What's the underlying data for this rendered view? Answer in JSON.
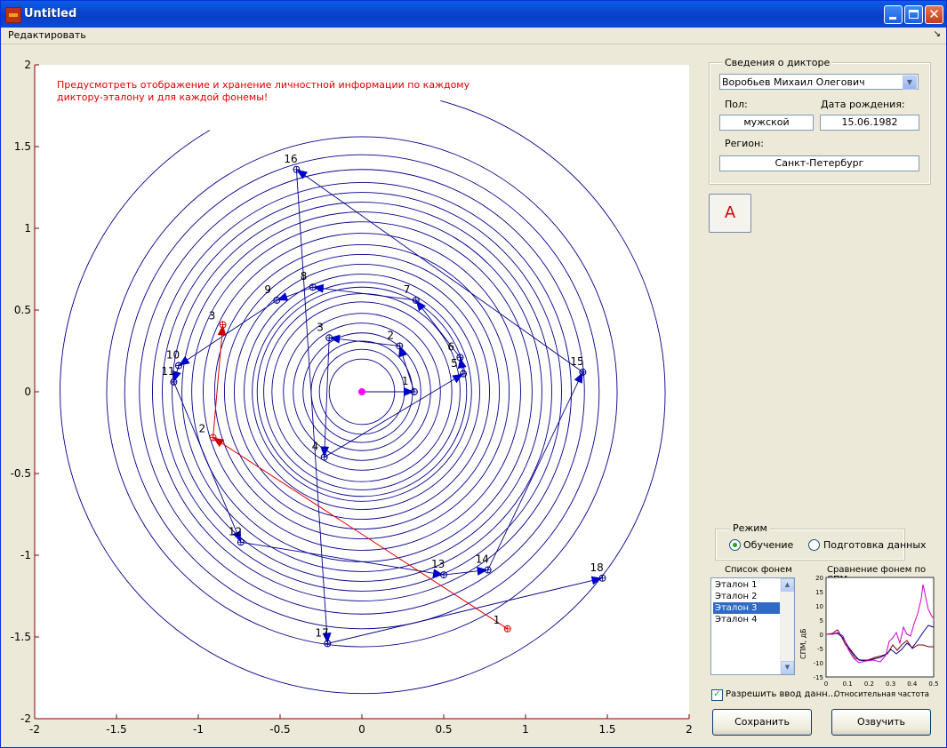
{
  "window": {
    "title": "Untitled"
  },
  "menu": {
    "edit": "Редактировать",
    "arrow": "↘"
  },
  "plot": {
    "note_line1": "Предусмотреть отображение  и хранение личностной информации по каждому",
    "note_line2": "диктору-эталону и для каждой фонемы!",
    "x_ticks": [
      "-2",
      "-1.5",
      "-1",
      "-0.5",
      "0",
      "0.5",
      "1",
      "1.5",
      "2"
    ],
    "y_ticks": [
      "2",
      "1.5",
      "1",
      "0.5",
      "0",
      "-0.5",
      "-1",
      "-1.5",
      "-2"
    ],
    "colors": {
      "axes": "#800000",
      "spiral": "#00008b",
      "red_path": "#e00000",
      "center": "#ff00ff",
      "note": "#e00000"
    },
    "blue_points": [
      {
        "label": "1",
        "x": 0.32,
        "y": 0.0
      },
      {
        "label": "2",
        "x": 0.23,
        "y": 0.28
      },
      {
        "label": "3",
        "x": -0.2,
        "y": 0.33
      },
      {
        "label": "4",
        "x": -0.23,
        "y": -0.4
      },
      {
        "label": "5",
        "x": 0.62,
        "y": 0.11
      },
      {
        "label": "6",
        "x": 0.6,
        "y": 0.21
      },
      {
        "label": "7",
        "x": 0.33,
        "y": 0.56
      },
      {
        "label": "8",
        "x": -0.3,
        "y": 0.64
      },
      {
        "label": "9",
        "x": -0.52,
        "y": 0.56
      },
      {
        "label": "10",
        "x": -1.12,
        "y": 0.16
      },
      {
        "label": "11",
        "x": -1.15,
        "y": 0.06
      },
      {
        "label": "12",
        "x": -0.74,
        "y": -0.92
      },
      {
        "label": "13",
        "x": 0.5,
        "y": -1.12
      },
      {
        "label": "14",
        "x": 0.77,
        "y": -1.09
      },
      {
        "label": "15",
        "x": 1.35,
        "y": 0.12
      },
      {
        "label": "16",
        "x": -0.4,
        "y": 1.36
      },
      {
        "label": "17",
        "x": -0.21,
        "y": -1.54
      },
      {
        "label": "18",
        "x": 1.47,
        "y": -1.14
      }
    ],
    "red_points": [
      {
        "label": "1",
        "x": 0.89,
        "y": -1.45
      },
      {
        "label": "2",
        "x": -0.91,
        "y": -0.28
      },
      {
        "label": "3",
        "x": -0.85,
        "y": 0.41
      }
    ]
  },
  "speaker_info": {
    "group_title": "Сведения о дикторе",
    "name": "Воробьев Михаил Олегович",
    "gender_label": "Пол:",
    "gender": "мужской",
    "birth_label": "Дата рождения:",
    "birth": "15.06.1982",
    "region_label": "Регион:",
    "region": "Санкт-Петербург"
  },
  "phoneme_button": "А",
  "mode": {
    "title": "Режим",
    "option1": "Обучение",
    "option2": "Подготовка данных",
    "selected": "Обучение"
  },
  "phoneme_list": {
    "title": "Список фонем",
    "items": [
      "Эталон 1",
      "Эталон 2",
      "Эталон 3",
      "Эталон 4"
    ],
    "selected_index": 2
  },
  "spectrum": {
    "title": "Сравнение фонем по СПМ",
    "ylabel": "СПМ, дБ",
    "xlabel": "Относительная частота",
    "y_ticks": [
      "20",
      "15",
      "10",
      "5",
      "0",
      "-5",
      "-10",
      "-15"
    ],
    "x_ticks": [
      "0",
      "0.1",
      "0.2",
      "0.3",
      "0.4",
      "0.5"
    ]
  },
  "allow_input": "Разрешить ввод данн...",
  "buttons": {
    "save": "Сохранить",
    "play": "Озвучить"
  }
}
